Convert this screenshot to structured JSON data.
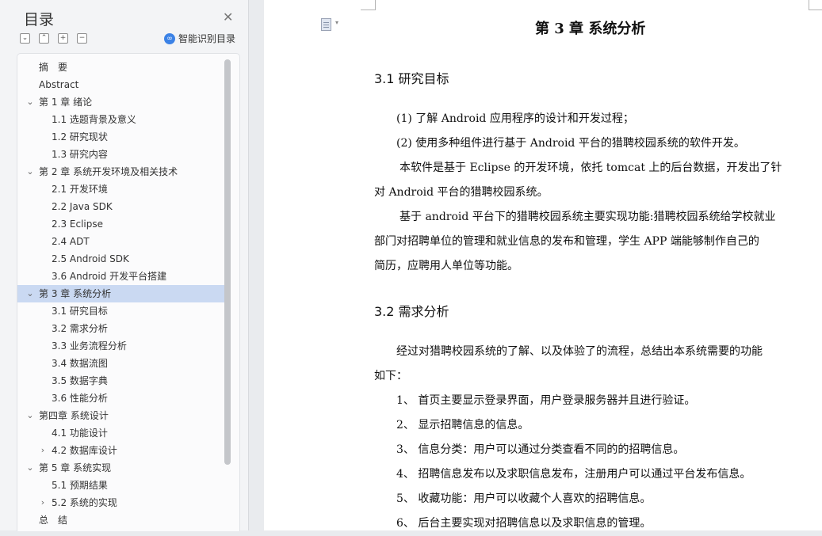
{
  "sidebar": {
    "title": "目录",
    "smart_label": "智能识别目录",
    "items": [
      {
        "label": "摘　要",
        "level": 0,
        "expand": "none"
      },
      {
        "label": "Abstract",
        "level": 0,
        "expand": "none"
      },
      {
        "label": "第 1 章  绪论",
        "level": 0,
        "expand": "open"
      },
      {
        "label": "1.1 选题背景及意义",
        "level": 1,
        "expand": "none"
      },
      {
        "label": "1.2 研究现状",
        "level": 1,
        "expand": "none"
      },
      {
        "label": "1.3  研究内容",
        "level": 1,
        "expand": "none"
      },
      {
        "label": "第 2 章  系统开发环境及相关技术",
        "level": 0,
        "expand": "open"
      },
      {
        "label": "2.1 开发环境",
        "level": 1,
        "expand": "none"
      },
      {
        "label": "2.2 Java SDK",
        "level": 1,
        "expand": "none"
      },
      {
        "label": "2.3 Eclipse",
        "level": 1,
        "expand": "none"
      },
      {
        "label": "2.4 ADT",
        "level": 1,
        "expand": "none"
      },
      {
        "label": "2.5 Android SDK",
        "level": 1,
        "expand": "none"
      },
      {
        "label": "3.6 Android 开发平台搭建",
        "level": 1,
        "expand": "none"
      },
      {
        "label": "第 3 章  系统分析",
        "level": 0,
        "expand": "open",
        "selected": true
      },
      {
        "label": "3.1  研究目标",
        "level": 1,
        "expand": "none"
      },
      {
        "label": "3.2  需求分析",
        "level": 1,
        "expand": "none"
      },
      {
        "label": "3.3  业务流程分析",
        "level": 1,
        "expand": "none"
      },
      {
        "label": "3.4  数据流图",
        "level": 1,
        "expand": "none"
      },
      {
        "label": "3.5  数据字典",
        "level": 1,
        "expand": "none"
      },
      {
        "label": "3.6  性能分析",
        "level": 1,
        "expand": "none"
      },
      {
        "label": "第四章  系统设计",
        "level": 0,
        "expand": "open"
      },
      {
        "label": "4.1  功能设计",
        "level": 1,
        "expand": "none"
      },
      {
        "label": "4.2  数据库设计",
        "level": 1,
        "expand": "closed"
      },
      {
        "label": "第 5 章  系统实现",
        "level": 0,
        "expand": "open"
      },
      {
        "label": "5.1 预期结果",
        "level": 1,
        "expand": "none"
      },
      {
        "label": "5.2 系统的实现",
        "level": 1,
        "expand": "closed"
      },
      {
        "label": "总　结",
        "level": 0,
        "expand": "none"
      }
    ]
  },
  "colors": {
    "selected": "#cad9f2",
    "accent": "#3b82e6"
  },
  "icons": [
    "close-icon",
    "collapse-all-icon",
    "expand-all-icon",
    "add-icon",
    "remove-icon",
    "smart-toc-icon",
    "document-icon"
  ],
  "document": {
    "chapter_title": "第 3 章  系统分析",
    "section1_heading": "3.1  研究目标",
    "s1_lines": [
      "(1)  了解 Android 应用程序的设计和开发过程；",
      "(2)  使用多种组件进行基于 Android  平台的猎聘校园系统的软件开发。",
      "本软件是基于 Eclipse 的开发环境，依托 tomcat 上的后台数据，开发出了针",
      "对 Android 平台的猎聘校园系统。",
      "基于 android 平台下的猎聘校园系统主要实现功能:猎聘校园系统给学校就业",
      "部门对招聘单位的管理和就业信息的发布和管理，学生 APP 端能够制作自己的",
      "简历，应聘用人单位等功能。"
    ],
    "section2_heading": "3.2  需求分析",
    "s2_lines": [
      "经过对猎聘校园系统的了解、以及体验了的流程，总结出本系统需要的功能",
      "如下：",
      "1、  首页主要显示登录界面，用户登录服务器并且进行验证。",
      "2、  显示招聘信息的信息。",
      "3、  信息分类：用户可以通过分类查看不同的的招聘信息。",
      "4、  招聘信息发布以及求职信息发布，注册用户可以通过平台发布信息。",
      "5、  收藏功能：用户可以收藏个人喜欢的招聘信息。",
      "6、  后台主要实现对招聘信息以及求职信息的管理。"
    ]
  }
}
